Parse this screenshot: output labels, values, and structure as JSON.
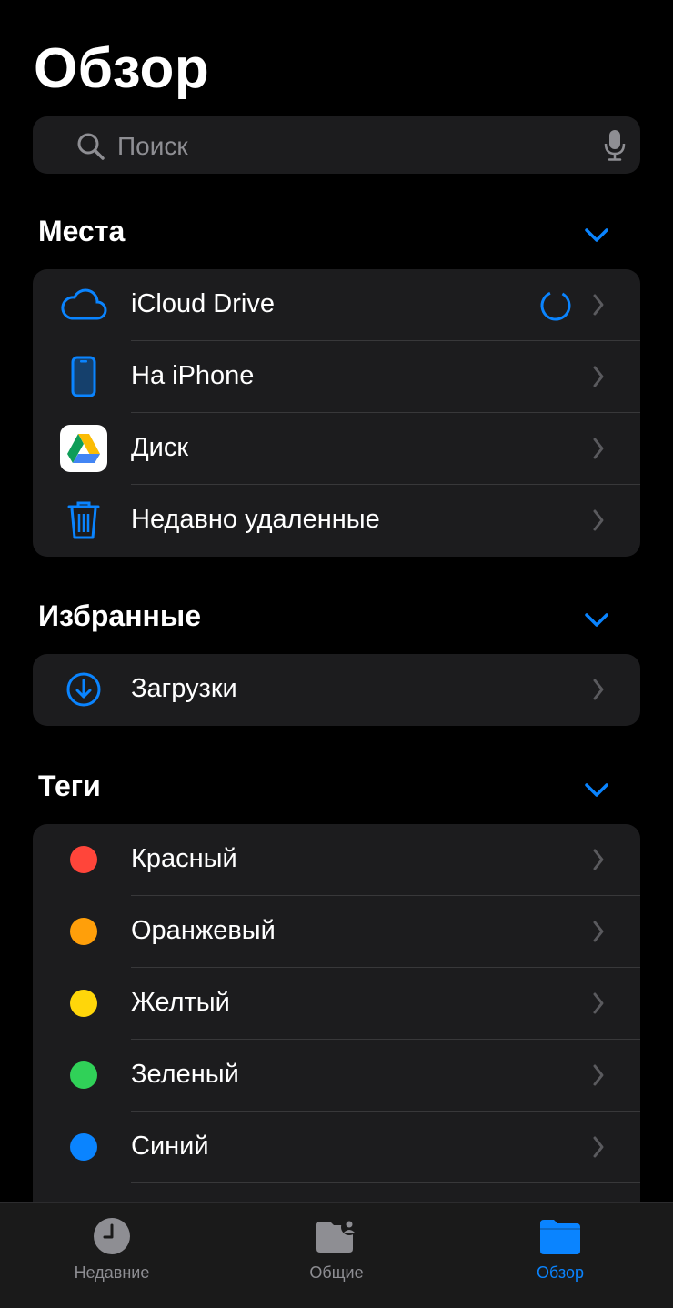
{
  "header": {
    "title": "Обзор"
  },
  "search": {
    "placeholder": "Поиск"
  },
  "sections": {
    "places": {
      "title": "Места",
      "items": [
        {
          "label": "iCloud Drive",
          "icon": "cloud-icon"
        },
        {
          "label": "На iPhone",
          "icon": "iphone-icon"
        },
        {
          "label": "Диск",
          "icon": "google-drive-icon"
        },
        {
          "label": "Недавно удаленные",
          "icon": "trash-icon"
        }
      ]
    },
    "favorites": {
      "title": "Избранные",
      "items": [
        {
          "label": "Загрузки",
          "icon": "download-icon"
        }
      ]
    },
    "tags": {
      "title": "Теги",
      "items": [
        {
          "label": "Красный",
          "color": "#ff453a"
        },
        {
          "label": "Оранжевый",
          "color": "#ff9f0a"
        },
        {
          "label": "Желтый",
          "color": "#ffd60a"
        },
        {
          "label": "Зеленый",
          "color": "#30d158"
        },
        {
          "label": "Синий",
          "color": "#0a84ff"
        }
      ]
    }
  },
  "tabbar": {
    "tabs": [
      {
        "label": "Недавние",
        "icon": "clock-icon",
        "active": false
      },
      {
        "label": "Общие",
        "icon": "shared-folder-icon",
        "active": false
      },
      {
        "label": "Обзор",
        "icon": "folder-icon",
        "active": true
      }
    ]
  },
  "colors": {
    "accent": "#0a84ff",
    "background": "#000000",
    "cell": "#1c1c1e"
  }
}
